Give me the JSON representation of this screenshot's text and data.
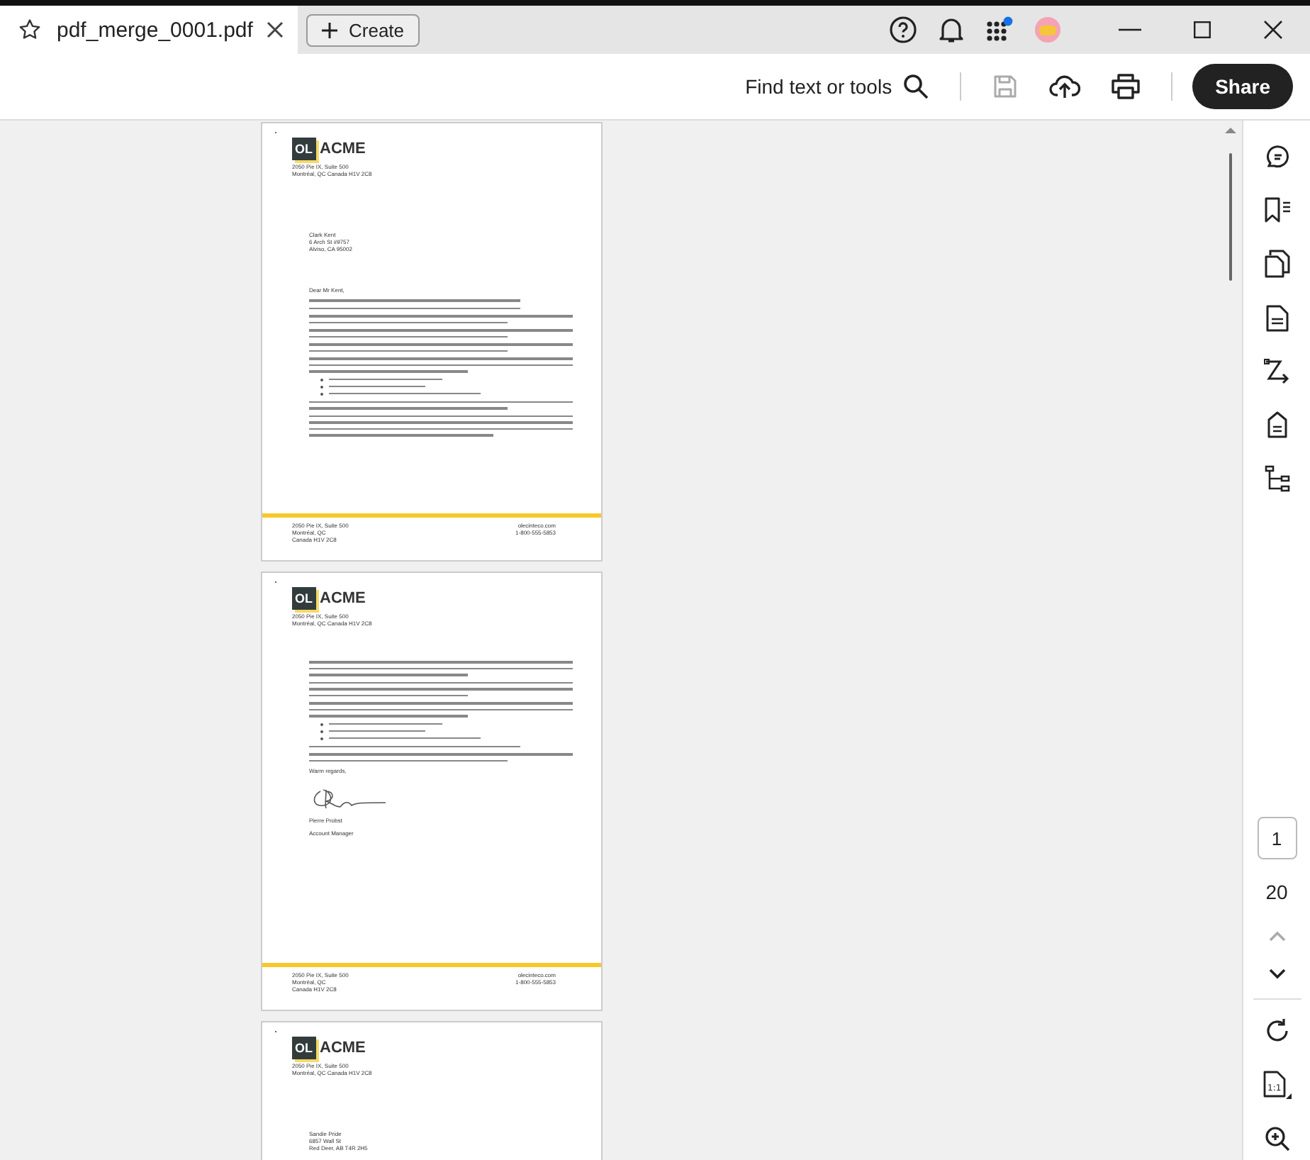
{
  "tab": {
    "title": "pdf_merge_0001.pdf",
    "selected": true
  },
  "create_button": "Create",
  "header_icons": [
    {
      "kind": "help"
    },
    {
      "kind": "bell"
    },
    {
      "kind": "apps",
      "badge": true
    },
    {
      "kind": "avatar"
    }
  ],
  "toolbar": {
    "search_label": "Find text or tools",
    "actions": [
      {
        "kind": "save",
        "disabled": true
      },
      {
        "kind": "upload",
        "disabled": false
      },
      {
        "kind": "print",
        "disabled": false
      }
    ],
    "share_button": "Share"
  },
  "pages": [
    {
      "logo_mark": "OL",
      "logo_name": "ACME",
      "header_address": [
        "2050 Pie IX, Suite 500",
        "Montréal, QC Canada H1V 2C8"
      ],
      "recipient": [
        "Clark Kent",
        "6 Arch St #9757",
        "Alviso, CA 95002"
      ],
      "body": [
        {
          "kind": "text",
          "text": "Dear Mr Kent,"
        },
        {
          "kind": "line"
        },
        {
          "kind": "line"
        },
        {
          "kind": "para2"
        },
        {
          "kind": "para2"
        },
        {
          "kind": "para2"
        },
        {
          "kind": "para3"
        },
        {
          "kind": "bullets"
        },
        {
          "kind": "para2"
        },
        {
          "kind": "para4"
        }
      ],
      "footer": {
        "address": [
          "2050 Pie IX, Suite 500",
          "Montréal, QC",
          "Canada H1V 2C8"
        ],
        "contact": [
          "olecinteco.com",
          "1-800-555-5853"
        ]
      }
    },
    {
      "logo_mark": "OL",
      "logo_name": "ACME",
      "header_address": [
        "2050 Pie IX, Suite 500",
        "Montréal, QC Canada H1V 2C8"
      ],
      "body": [
        {
          "kind": "para3"
        },
        {
          "kind": "para3"
        },
        {
          "kind": "para3"
        },
        {
          "kind": "bullets"
        },
        {
          "kind": "line"
        },
        {
          "kind": "para2"
        },
        {
          "kind": "text",
          "text": "Warm regards,"
        },
        {
          "kind": "signature"
        },
        {
          "kind": "text",
          "text": "Pierre Probst"
        },
        {
          "kind": "text",
          "text": "Account Manager"
        }
      ],
      "footer": {
        "address": [
          "2050 Pie IX, Suite 500",
          "Montréal, QC",
          "Canada H1V 2C8"
        ],
        "contact": [
          "olecinteco.com",
          "1-800-555-5853"
        ]
      }
    },
    {
      "logo_mark": "OL",
      "logo_name": "ACME",
      "header_address": [
        "2050 Pie IX, Suite 500",
        "Montréal, QC Canada H1V 2C8"
      ],
      "recipient": [
        "Sandie Pride",
        "6857 Wall St",
        "Red Deer, AB T4R 2H5"
      ]
    }
  ],
  "sidebar_tools": [
    {
      "kind": "comment"
    },
    {
      "kind": "bookmarks"
    },
    {
      "kind": "pages"
    },
    {
      "kind": "document"
    },
    {
      "kind": "convert"
    },
    {
      "kind": "tag"
    },
    {
      "kind": "tree"
    }
  ],
  "page_nav": {
    "current": "1",
    "total": "20",
    "up_disabled": true,
    "down_disabled": false
  },
  "view_tools": [
    {
      "kind": "rotate"
    },
    {
      "kind": "fit",
      "label": "1:1"
    },
    {
      "kind": "zoom"
    }
  ]
}
